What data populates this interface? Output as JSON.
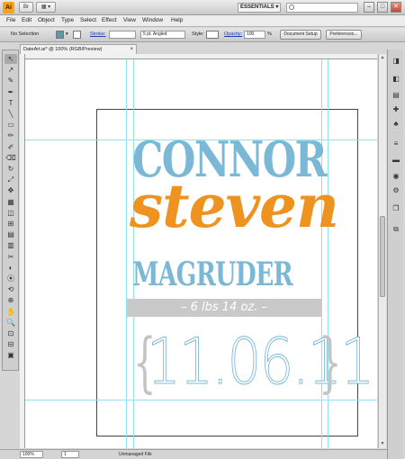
{
  "app": {
    "logo": "Ai",
    "bridge_label": "Br",
    "arrange_label": "▦ ▾",
    "workspace": "ESSENTIALS ▾",
    "window_controls": [
      "–",
      "□",
      "✕"
    ]
  },
  "menu": [
    "File",
    "Edit",
    "Object",
    "Type",
    "Select",
    "Effect",
    "View",
    "Window",
    "Help"
  ],
  "control_bar": {
    "selection_label": "No Selection",
    "fill_color": "#5b9aa8",
    "stroke_label": "Stroke:",
    "stroke_value": "",
    "brush_value": "5 pt. Angled",
    "style_label": "Style:",
    "opacity_label": "Opacity:",
    "opacity_value": "100",
    "opacity_unit": "%",
    "doc_setup_label": "Document Setup",
    "preferences_label": "Preferences..."
  },
  "document": {
    "tab_title": "DateArt.ai* @ 100% (RGB/Preview)",
    "tab_close": "×"
  },
  "artwork": {
    "first_name": "CONNOR",
    "middle_name": "steven",
    "last_name": "MAGRUDER",
    "weight": "– 6 lbs 14 oz. –",
    "date": "11.06.11",
    "brace_left": "{",
    "brace_right": "}",
    "colors": {
      "blue": "#7bb8d6",
      "orange": "#ee9320",
      "gray": "#c9c9c9"
    }
  },
  "tools": [
    "↖",
    "↗",
    "✎",
    "✒",
    "T",
    "╲",
    "▭",
    "✏",
    "✐",
    "⌫",
    "↻",
    "⤢",
    "✥",
    "▦",
    "◫",
    "⊞",
    "▤",
    "▥",
    "✂",
    "◐",
    "⦿",
    "⟲",
    "⊕",
    "✋",
    "🔍",
    "⊡",
    "⊟",
    "▣"
  ],
  "dock_icons": [
    "◨",
    "◧",
    "▤",
    "✚",
    "♣",
    "≡",
    "▬",
    "◉",
    "⚙",
    "❒",
    "⧉"
  ],
  "status_bar": {
    "zoom": "100%",
    "artboard_number": "1",
    "status_text": "Unmanaged File"
  }
}
